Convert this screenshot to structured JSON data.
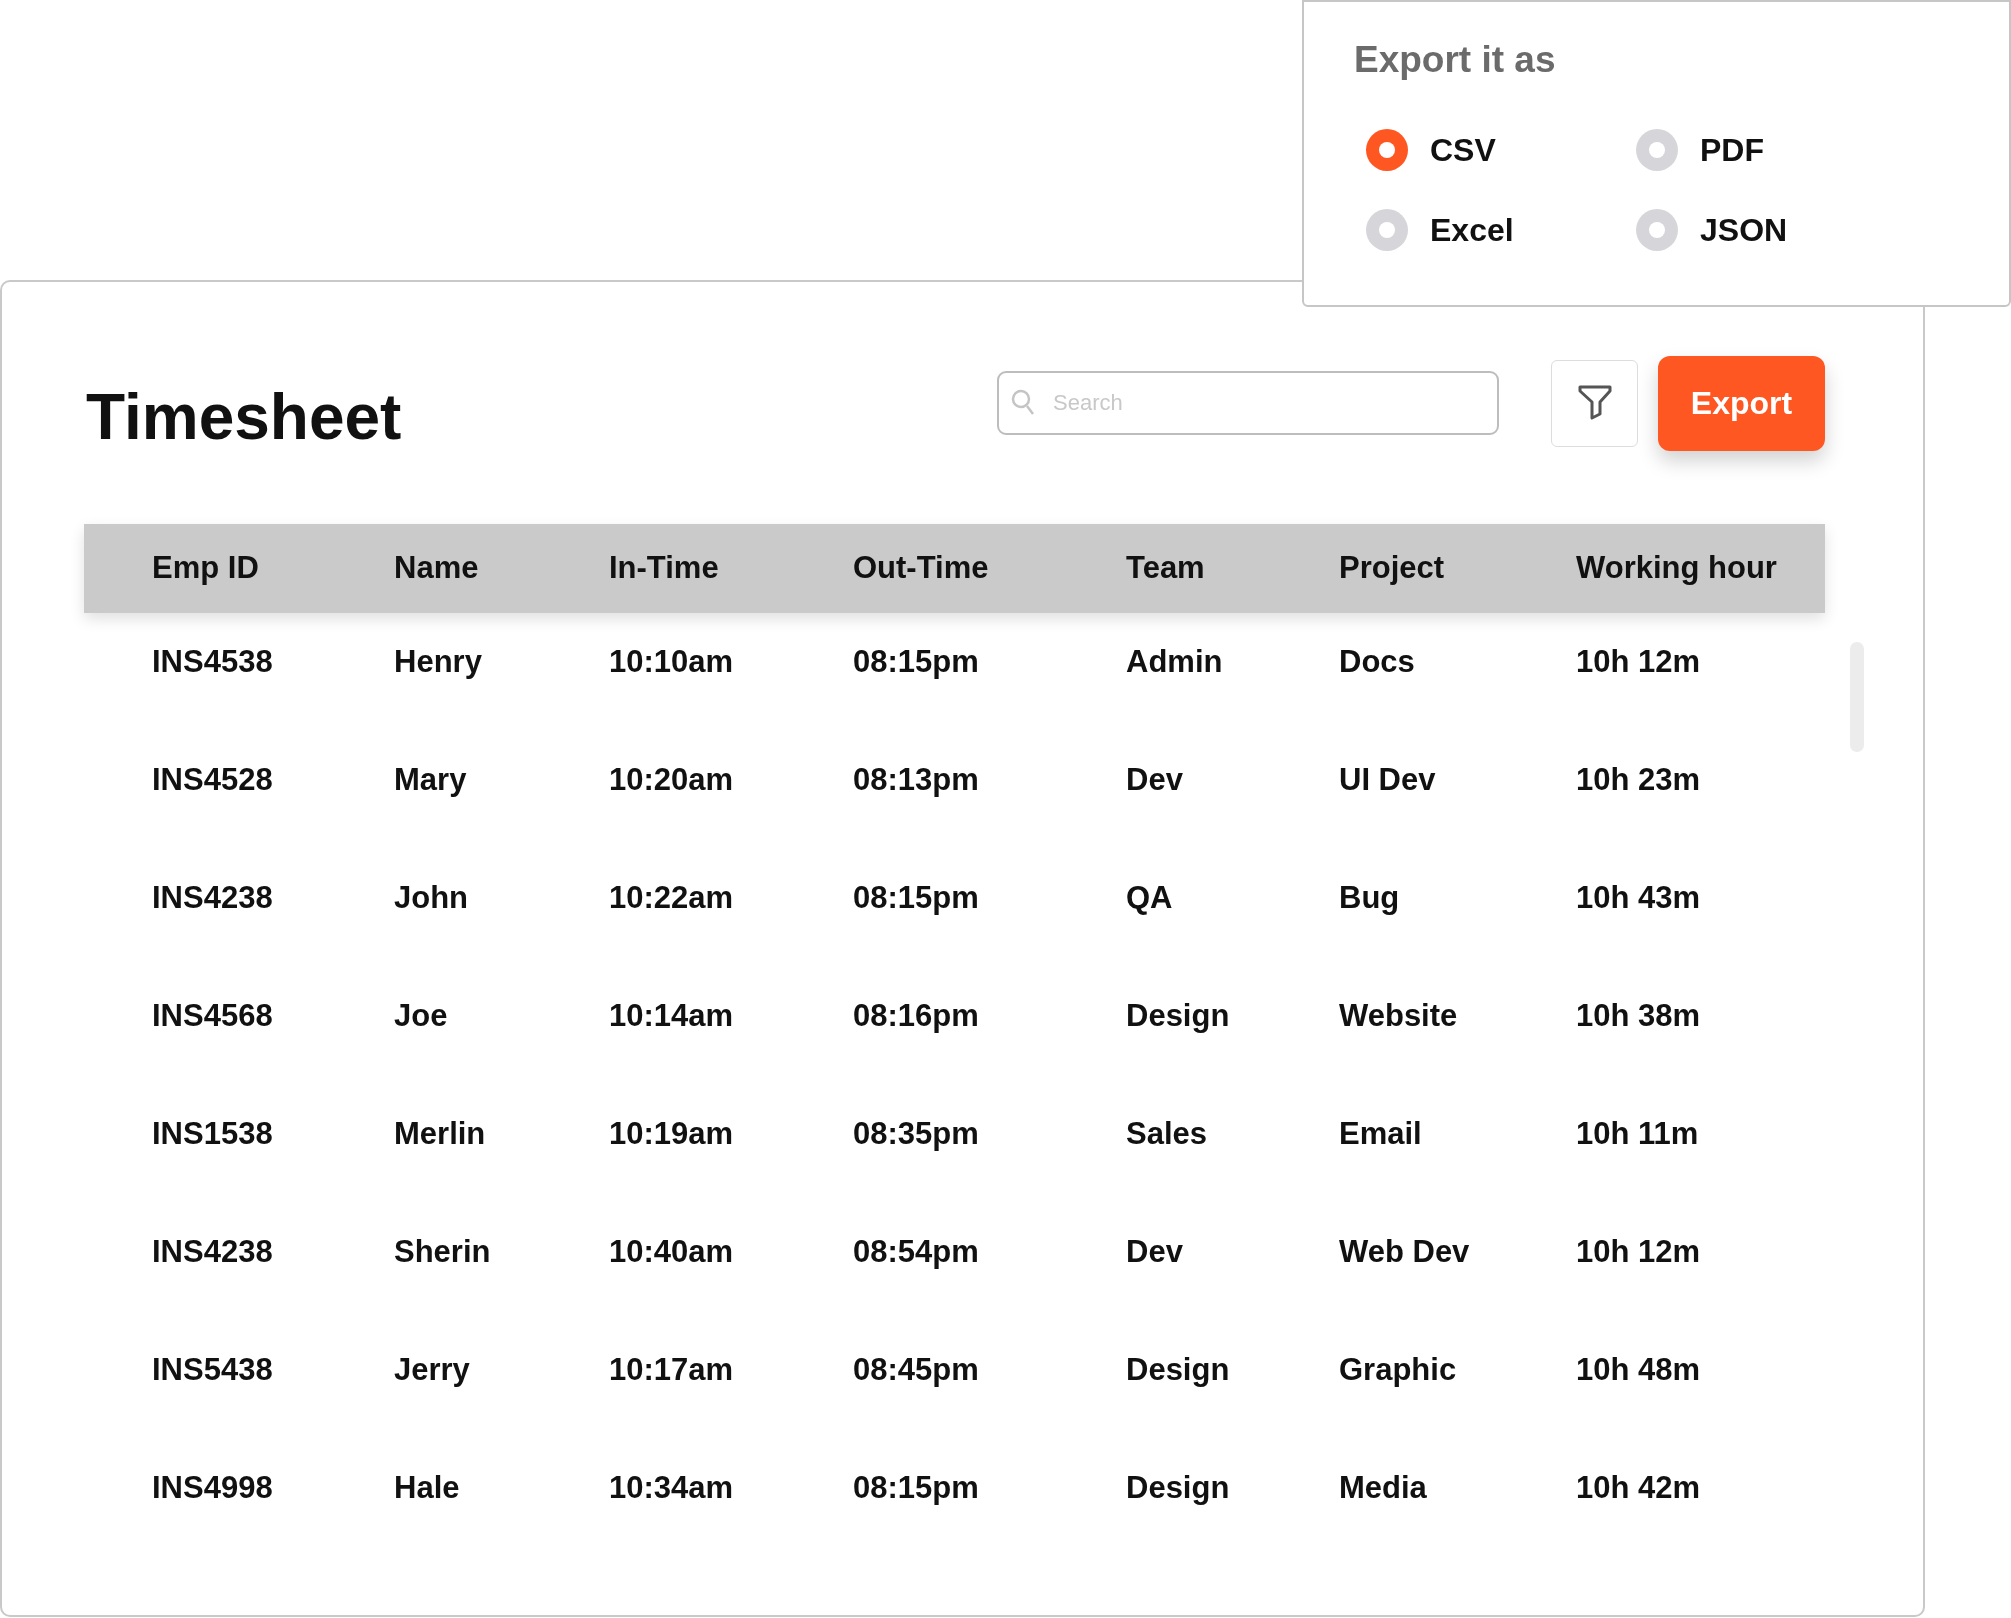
{
  "page_title": "Timesheet",
  "search": {
    "placeholder": "Search"
  },
  "export_button": "Export",
  "export_menu": {
    "title": "Export it as",
    "options": [
      {
        "label": "CSV",
        "selected": true
      },
      {
        "label": "PDF",
        "selected": false
      },
      {
        "label": "Excel",
        "selected": false
      },
      {
        "label": "JSON",
        "selected": false
      }
    ]
  },
  "table": {
    "columns": [
      "Emp ID",
      "Name",
      "In-Time",
      "Out-Time",
      "Team",
      "Project",
      "Working hour"
    ],
    "rows": [
      [
        "INS4538",
        "Henry",
        "10:10am",
        "08:15pm",
        "Admin",
        "Docs",
        "10h 12m"
      ],
      [
        "INS4528",
        "Mary",
        "10:20am",
        "08:13pm",
        "Dev",
        "UI Dev",
        "10h 23m"
      ],
      [
        "INS4238",
        "John",
        "10:22am",
        "08:15pm",
        "QA",
        "Bug",
        "10h 43m"
      ],
      [
        "INS4568",
        "Joe",
        "10:14am",
        "08:16pm",
        "Design",
        "Website",
        "10h 38m"
      ],
      [
        "INS1538",
        "Merlin",
        "10:19am",
        "08:35pm",
        "Sales",
        "Email",
        "10h 11m"
      ],
      [
        "INS4238",
        "Sherin",
        "10:40am",
        "08:54pm",
        "Dev",
        "Web Dev",
        "10h 12m"
      ],
      [
        "INS5438",
        "Jerry",
        "10:17am",
        "08:45pm",
        "Design",
        "Graphic",
        "10h 48m"
      ],
      [
        "INS4998",
        "Hale",
        "10:34am",
        "08:15pm",
        "Design",
        "Media",
        "10h 42m"
      ]
    ]
  }
}
